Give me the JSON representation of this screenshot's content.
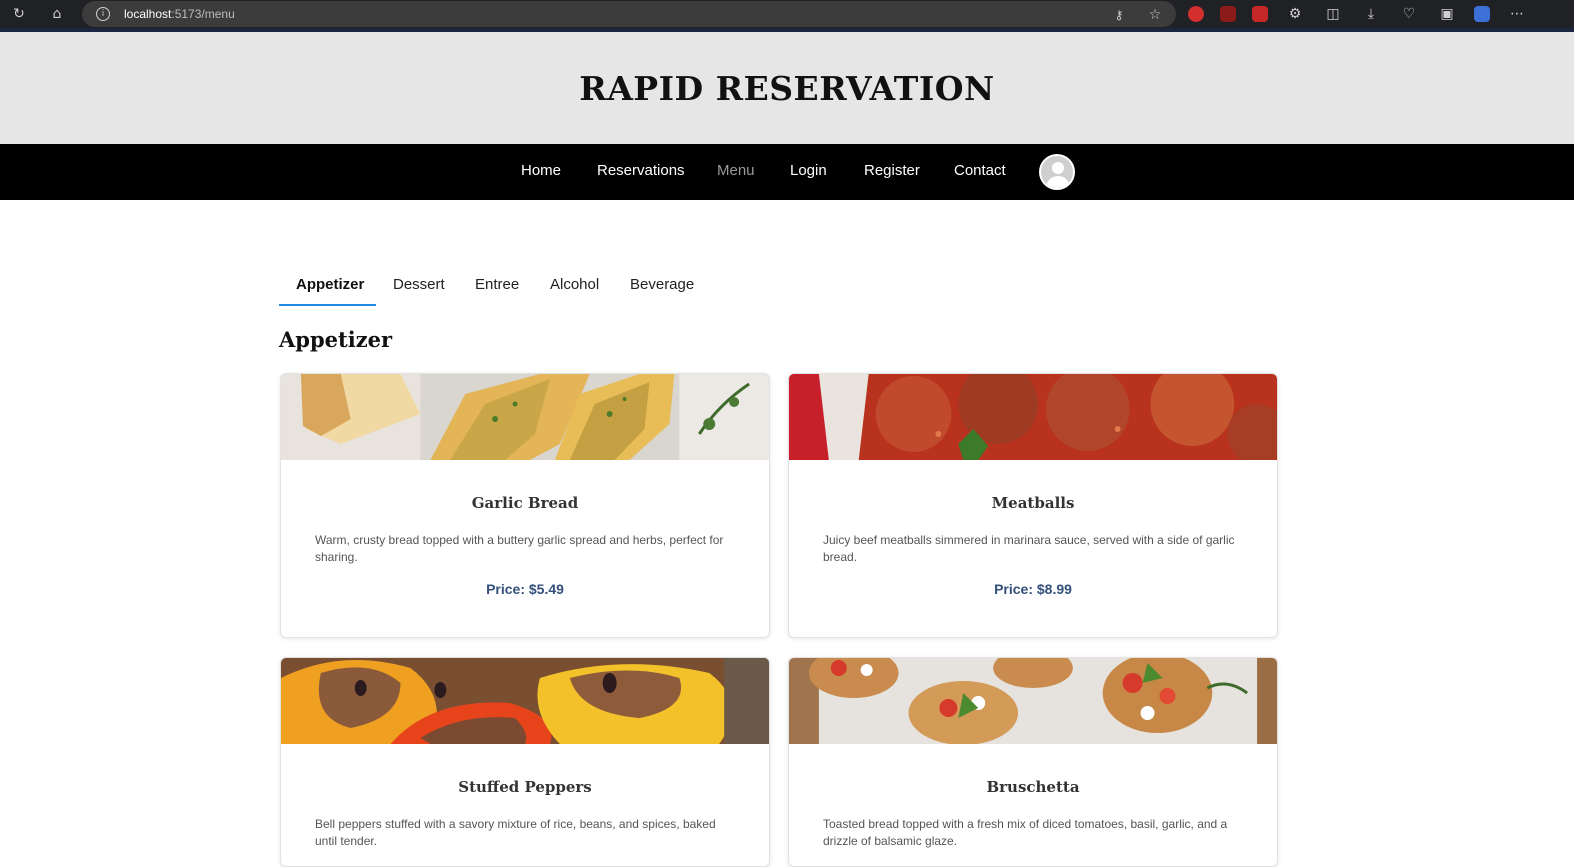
{
  "browser": {
    "url_host": "localhost",
    "url_path": ":5173/menu",
    "icons": [
      "reload-icon",
      "home-icon",
      "info-icon",
      "key-icon",
      "star-icon",
      "split-icon",
      "download-icon",
      "menu-icon"
    ]
  },
  "header": {
    "title": "RAPID RESERVATION"
  },
  "nav": {
    "items": [
      {
        "label": "Home"
      },
      {
        "label": "Reservations"
      },
      {
        "label": "Menu"
      },
      {
        "label": "Login"
      },
      {
        "label": "Register"
      },
      {
        "label": "Contact"
      }
    ],
    "active": "Menu"
  },
  "tabs": {
    "items": [
      {
        "label": "Appetizer"
      },
      {
        "label": "Dessert"
      },
      {
        "label": "Entree"
      },
      {
        "label": "Alcohol"
      },
      {
        "label": "Beverage"
      }
    ],
    "active": "Appetizer"
  },
  "section": {
    "title": "Appetizer"
  },
  "items": [
    {
      "name": "Garlic Bread",
      "description": "Warm, crusty bread topped with a buttery garlic spread and herbs, perfect for sharing.",
      "price": "Price: $5.49"
    },
    {
      "name": "Meatballs",
      "description": "Juicy beef meatballs simmered in marinara sauce, served with a side of garlic bread.",
      "price": "Price: $8.99"
    },
    {
      "name": "Stuffed Peppers",
      "description": "Bell peppers stuffed with a savory mixture of rice, beans, and spices, baked until tender.",
      "price": ""
    },
    {
      "name": "Bruschetta",
      "description": "Toasted bread topped with a fresh mix of diced tomatoes, basil, garlic, and a drizzle of balsamic glaze.",
      "price": ""
    }
  ],
  "colors": {
    "header_bg": "#e6e6e6",
    "nav_bg": "#000000",
    "tab_accent": "#1e88e5",
    "price": "#34507a"
  }
}
